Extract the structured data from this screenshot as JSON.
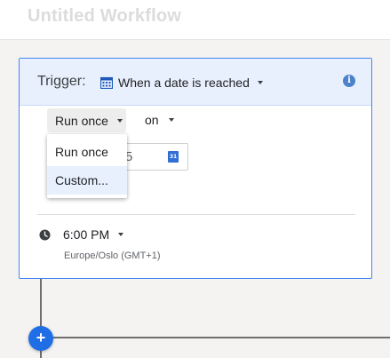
{
  "header": {
    "title": "Untitled Workflow"
  },
  "trigger": {
    "label": "Trigger:",
    "value": "When a date is reached",
    "icon": "calendar-icon",
    "info_icon": "info-icon"
  },
  "schedule": {
    "repeat_value": "Run once",
    "on_label": "on",
    "date_partial": "5",
    "calendar_icon_text": "31",
    "dropdown": {
      "options": [
        "Run once",
        "Custom..."
      ],
      "highlighted": "Custom..."
    }
  },
  "time": {
    "value": "6:00 PM",
    "timezone": "Europe/Oslo (GMT+1)"
  },
  "add_button": {
    "label": "+"
  },
  "colors": {
    "accent": "#4285f4",
    "header_bg": "#e8f0fe",
    "add_button": "#1f6ee6"
  }
}
